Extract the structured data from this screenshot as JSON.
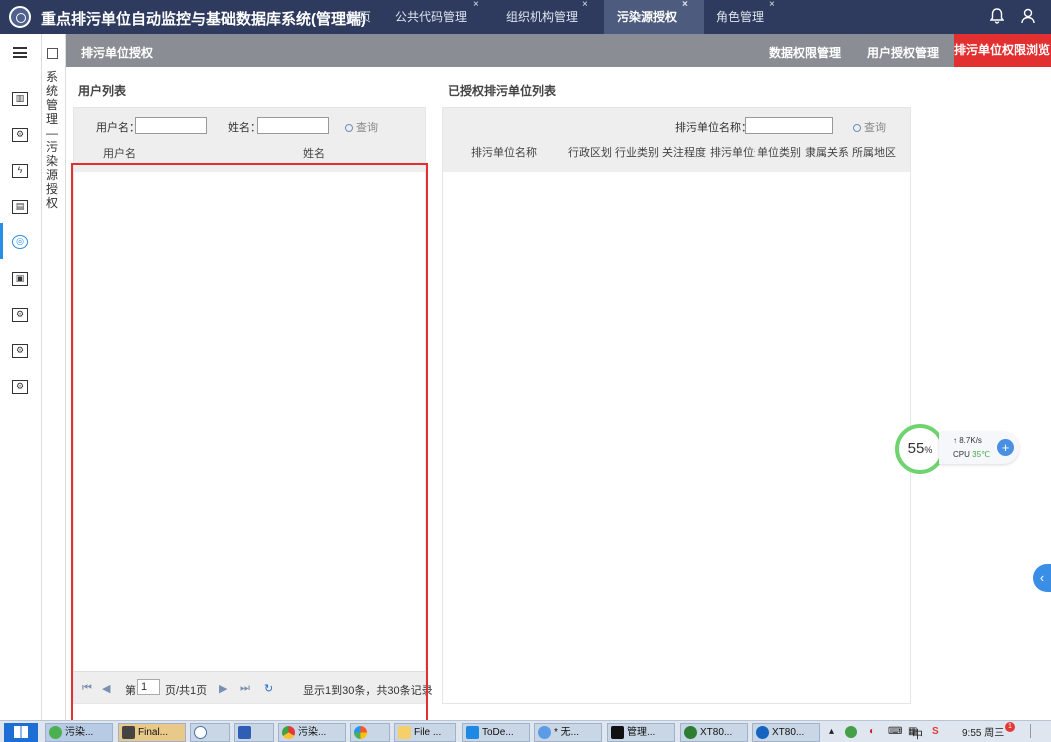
{
  "header": {
    "app_title": "重点排污单位自动监控与基础数据库系统(管理端)",
    "tabs": [
      {
        "label": "首页",
        "closable": false
      },
      {
        "label": "公共代码管理",
        "closable": true
      },
      {
        "label": "组织机构管理",
        "closable": true
      },
      {
        "label": "污染源授权",
        "closable": true,
        "active": true
      },
      {
        "label": "角色管理",
        "closable": true
      }
    ],
    "close_glyph": "×"
  },
  "sidebar": {
    "icons": [
      "menu-icon",
      "monitor-chart-icon",
      "settings-grid-icon",
      "lightning-doc-icon",
      "chart-screen-icon",
      "location-icon",
      "image-icon",
      "table-settings-icon",
      "window-settings-icon",
      "grid-settings-icon"
    ],
    "subnav_text": "系统管理—污染源授权"
  },
  "titlebar": {
    "left_label": "排污单位授权",
    "links": [
      "数据权限管理",
      "用户授权管理"
    ],
    "active_link": "排污单位权限浏览"
  },
  "left_panel": {
    "title": "用户列表",
    "filter": {
      "username_label": "用户名：",
      "name_label": "姓名：",
      "query_label": "查询"
    },
    "columns": [
      "用户名",
      "姓名"
    ],
    "pager": {
      "page_prefix": "第",
      "page_value": "1",
      "page_suffix": "页/共1页",
      "summary": "显示1到30条，共30条记录"
    }
  },
  "right_panel": {
    "title": "已授权排污单位列表",
    "filter": {
      "unit_name_label": "排污单位名称：",
      "query_label": "查询"
    },
    "columns": [
      "排污单位名称",
      "行政区划",
      "行业类别",
      "关注程度",
      "排污单位规",
      "单位类别",
      "隶属关系",
      "所属地区"
    ]
  },
  "monitor_widget": {
    "percent": "55",
    "percent_unit": "%",
    "speed": "8.7K/s",
    "cpu_label": "CPU",
    "cpu_temp": "35℃"
  },
  "taskbar": {
    "items": [
      "污染...",
      "Final...",
      "",
      "",
      "污染...",
      "",
      "File ...",
      "ToDe...",
      "* 无...",
      "管理...",
      "XT80...",
      "XT80..."
    ],
    "time": "9:55 周三",
    "ime": "中",
    "badge": "1"
  },
  "colors": {
    "header_bg": "#2e3b5e",
    "titlebar_bg": "#8a8d93",
    "accent_red": "#e23030",
    "accent_blue": "#2a8ee6"
  }
}
